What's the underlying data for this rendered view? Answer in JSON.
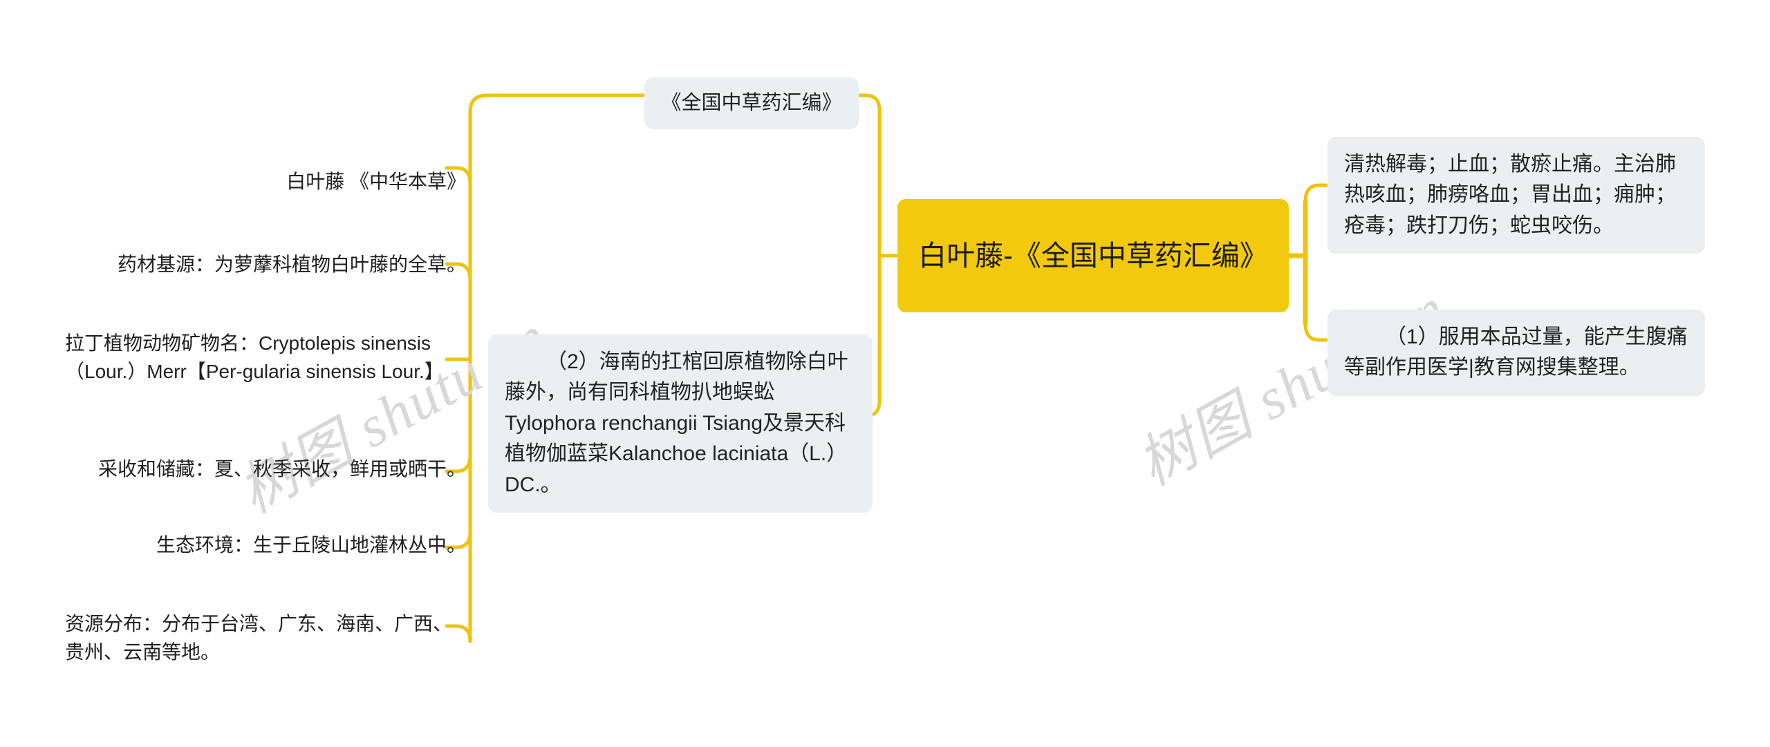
{
  "diagram": {
    "kind": "mindmap",
    "watermark": "树图 shutu.cn",
    "colors": {
      "root_fill": "#F2C90C",
      "branch_line": "#EFC20C",
      "node_fill": "#ECEFF1",
      "text": "#222222",
      "canvas": "#FFFFFF"
    }
  },
  "root": {
    "label": "白叶藤-《全国中草药汇编》"
  },
  "branches": {
    "top_center": {
      "label": "《全国中草药汇编》"
    },
    "right": [
      {
        "label": "清热解毒；止血；散瘀止痛。主治肺热咳血；肺痨咯血；胃出血；痈肿；疮毒；跌打刀伤；蛇虫咬伤。"
      },
      {
        "label": "（1）服用本品过量，能产生腹痛等副作用医学|教育网搜集整理。"
      }
    ],
    "middle": {
      "label": "（2）海南的扛棺回原植物除白叶藤外，尚有同科植物扒地蜈蚣Tylophora renchangii Tsiang及景天科植物伽蓝菜Kalanchoe laciniata（L.）DC.。"
    },
    "left": [
      {
        "label": "白叶藤 《中华本草》"
      },
      {
        "label": "药材基源：为萝藦科植物白叶藤的全草。"
      },
      {
        "label": "拉丁植物动物矿物名：Cryptolepis sinensis（Lour.）Merr【Per-gularia sinensis Lour.】"
      },
      {
        "label": "采收和储藏：夏、秋季采收，鲜用或晒干。"
      },
      {
        "label": "生态环境：生于丘陵山地灌林丛中。"
      },
      {
        "label": "资源分布：分布于台湾、广东、海南、广西、贵州、云南等地。"
      }
    ]
  }
}
